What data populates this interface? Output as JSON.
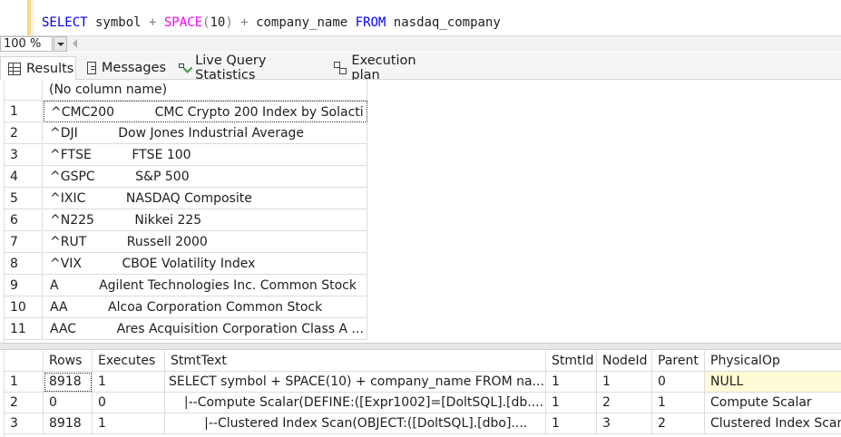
{
  "editor": {
    "sql_tokens": {
      "select": "SELECT",
      "symbol": " symbol ",
      "plus1": "+",
      "space_fn": " SPACE",
      "paren_open": "(",
      "ten": "10",
      "paren_close": ")",
      "plus2": " + ",
      "company_name": "company_name ",
      "from": "FROM",
      "table": " nasdaq_company"
    }
  },
  "zoom": {
    "value": "100 %"
  },
  "tabs": {
    "results": "Results",
    "messages": "Messages",
    "live_stats": "Live Query Statistics",
    "execution_plan": "Execution plan"
  },
  "grid1": {
    "column_header": "(No column name)",
    "rows": [
      {
        "n": "1",
        "value": "^CMC200          CMC Crypto 200 Index by Solacti"
      },
      {
        "n": "2",
        "value": "^DJI          Dow Jones Industrial Average"
      },
      {
        "n": "3",
        "value": "^FTSE          FTSE 100"
      },
      {
        "n": "4",
        "value": "^GSPC          S&P 500"
      },
      {
        "n": "5",
        "value": "^IXIC          NASDAQ Composite"
      },
      {
        "n": "6",
        "value": "^N225          Nikkei 225"
      },
      {
        "n": "7",
        "value": "^RUT          Russell 2000"
      },
      {
        "n": "8",
        "value": "^VIX          CBOE Volatility Index"
      },
      {
        "n": "9",
        "value": "A          Agilent Technologies Inc. Common Stock"
      },
      {
        "n": "10",
        "value": "AA          Alcoa Corporation Common Stock"
      },
      {
        "n": "11",
        "value": "AAC          Ares Acquisition Corporation Class A ..."
      }
    ]
  },
  "grid2": {
    "headers": [
      "Rows",
      "Executes",
      "StmtText",
      "StmtId",
      "NodeId",
      "Parent",
      "PhysicalOp"
    ],
    "rows": [
      {
        "n": "1",
        "cells": [
          "8918",
          "1",
          "SELECT symbol + SPACE(10) + company_name FROM na...",
          "1",
          "1",
          "0",
          "NULL"
        ]
      },
      {
        "n": "2",
        "cells": [
          "0",
          "0",
          "  |--Compute Scalar(DEFINE:([Expr1002]=[DoltSQL].[db....",
          "1",
          "2",
          "1",
          "Compute Scalar"
        ]
      },
      {
        "n": "3",
        "cells": [
          "8918",
          "1",
          "       |--Clustered Index Scan(OBJECT:([DoltSQL].[dbo]....",
          "1",
          "3",
          "2",
          "Clustered Index Scan"
        ]
      }
    ]
  }
}
